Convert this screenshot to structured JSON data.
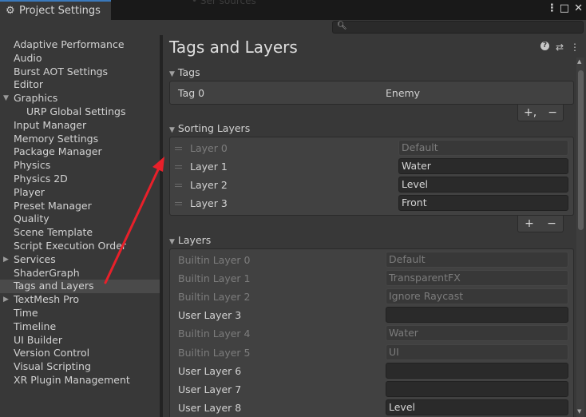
{
  "window": {
    "tab_title": "Project Settings",
    "faint_title_fragment": "• Ser sources",
    "icons": [
      "settings-gear-icon",
      "kebab-menu-icon",
      "maximize-icon",
      "close-icon"
    ]
  },
  "search": {
    "placeholder": "",
    "icon": "search-icon"
  },
  "sidebar": {
    "items": [
      {
        "label": "Adaptive Performance"
      },
      {
        "label": "Audio"
      },
      {
        "label": "Burst AOT Settings"
      },
      {
        "label": "Editor"
      },
      {
        "label": "Graphics",
        "expanded": true
      },
      {
        "label": "URP Global Settings",
        "child": true
      },
      {
        "label": "Input Manager"
      },
      {
        "label": "Memory Settings"
      },
      {
        "label": "Package Manager"
      },
      {
        "label": "Physics"
      },
      {
        "label": "Physics 2D"
      },
      {
        "label": "Player"
      },
      {
        "label": "Preset Manager"
      },
      {
        "label": "Quality"
      },
      {
        "label": "Scene Template"
      },
      {
        "label": "Script Execution Order"
      },
      {
        "label": "Services",
        "collapsed": true
      },
      {
        "label": "ShaderGraph"
      },
      {
        "label": "Tags and Layers",
        "selected": true
      },
      {
        "label": "TextMesh Pro",
        "collapsed": true
      },
      {
        "label": "Time"
      },
      {
        "label": "Timeline"
      },
      {
        "label": "UI Builder"
      },
      {
        "label": "Version Control"
      },
      {
        "label": "Visual Scripting"
      },
      {
        "label": "XR Plugin Management"
      }
    ]
  },
  "main": {
    "title": "Tags and Layers",
    "header_icons": [
      "help-icon",
      "presets-icon",
      "kebab-menu-icon"
    ],
    "tags": {
      "header": "Tags",
      "rows": [
        {
          "label": "Tag 0",
          "value": "Enemy"
        }
      ],
      "add": "+,",
      "remove": "−"
    },
    "sorting_layers": {
      "header": "Sorting Layers",
      "rows": [
        {
          "label": "Layer 0",
          "value": "Default",
          "readonly": true
        },
        {
          "label": "Layer 1",
          "value": "Water"
        },
        {
          "label": "Layer 2",
          "value": "Level"
        },
        {
          "label": "Layer 3",
          "value": "Front"
        }
      ],
      "add": "+",
      "remove": "−"
    },
    "layers": {
      "header": "Layers",
      "rows": [
        {
          "label": "Builtin Layer 0",
          "value": "Default",
          "readonly": true
        },
        {
          "label": "Builtin Layer 1",
          "value": "TransparentFX",
          "readonly": true
        },
        {
          "label": "Builtin Layer 2",
          "value": "Ignore Raycast",
          "readonly": true
        },
        {
          "label": "User Layer 3",
          "value": ""
        },
        {
          "label": "Builtin Layer 4",
          "value": "Water",
          "readonly": true
        },
        {
          "label": "Builtin Layer 5",
          "value": "UI",
          "readonly": true
        },
        {
          "label": "User Layer 6",
          "value": ""
        },
        {
          "label": "User Layer 7",
          "value": ""
        },
        {
          "label": "User Layer 8",
          "value": "Level"
        }
      ]
    }
  },
  "colors": {
    "accent": "#3a79bb",
    "annotation_arrow": "#e8202a",
    "selected_row": "#4a4a4a"
  }
}
